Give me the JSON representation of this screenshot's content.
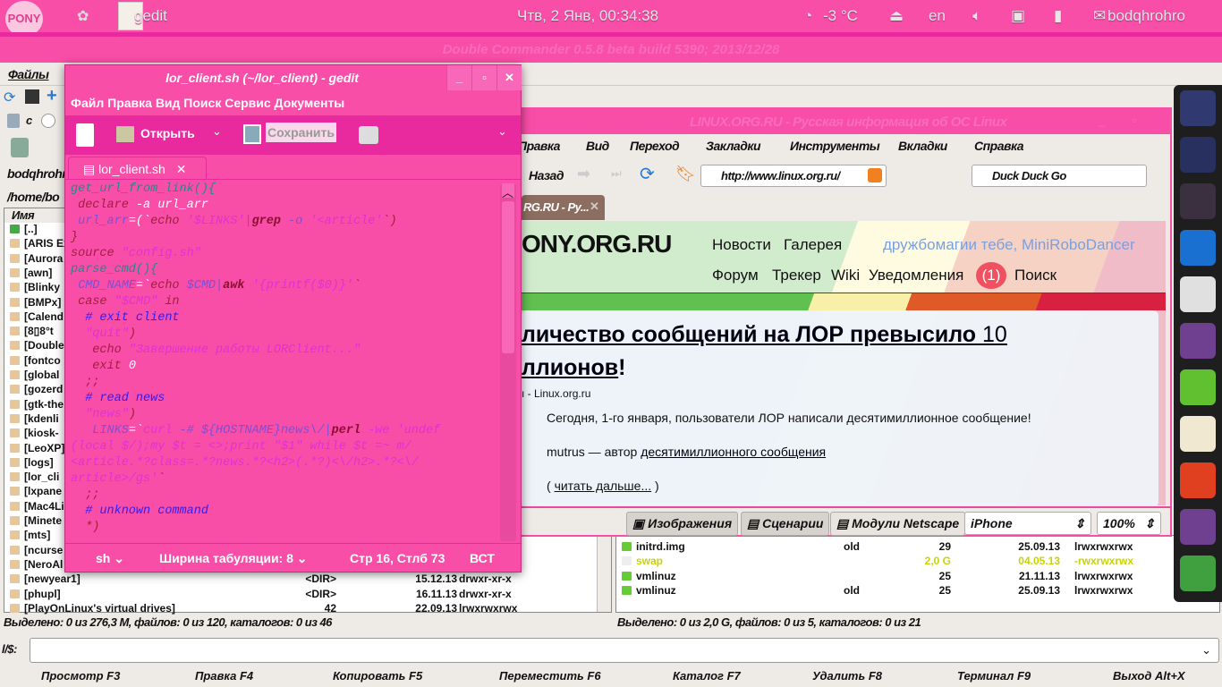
{
  "top_panel": {
    "app_name": "gedit",
    "clock": "Чтв,  2 Янв, 00:34:38",
    "weather": "-3 °C",
    "keyboard": "en",
    "user": "bodqhrohro",
    "logo_text": "My Little Pony"
  },
  "dc": {
    "title": "Double Commander 0.5.8 beta build 5390; 2013/12/28",
    "menu": [
      "Файлы"
    ],
    "drive_label": "c",
    "left": {
      "host": "bodqhrohro",
      "path": "/home/bo",
      "col_name": "Имя",
      "rows": [
        "[..]",
        "[ARIS Ex",
        "[Aurora",
        "[awn]",
        "[Blinky",
        "[BMPx]",
        "[Calend",
        "[8▯8°t",
        "[Double",
        "[fontco",
        "[global",
        "[gozerd",
        "[gtk-the",
        "[kdenli",
        "[kiosk-",
        "[LeoXP]",
        "[logs]",
        "[lor_cli",
        "[lxpane",
        "[Mac4Li",
        "[Minete",
        "[mts]",
        "[ncurse",
        "[NeroAl"
      ],
      "full_rows": [
        {
          "name": "[newyear1]",
          "size": "<DIR>",
          "date": "15.12.13",
          "attr": "drwxr-xr-x"
        },
        {
          "name": "[phupl]",
          "size": "<DIR>",
          "date": "16.11.13",
          "attr": "drwxr-xr-x"
        },
        {
          "name": "[PlayOnLinux's virtual drives]",
          "size": "42",
          "date": "22.09.13",
          "attr": "lrwxrwxrwx"
        }
      ],
      "status": "Выделено: 0 из 276,3 M, файлов: 0 из 120, каталогов: 0 из 46"
    },
    "right": {
      "rows": [
        {
          "name": "initrd.img",
          "ext": "old",
          "size": "29",
          "date": "25.09.13",
          "attr": "lrwxrwxrwx"
        },
        {
          "name": "swap",
          "ext": "",
          "size": "2,0 G",
          "date": "04.05.13",
          "attr": "-rwxrwxrwx",
          "highlight": "#c8d400"
        },
        {
          "name": "vmlinuz",
          "ext": "",
          "size": "25",
          "date": "21.11.13",
          "attr": "lrwxrwxrwx"
        },
        {
          "name": "vmlinuz",
          "ext": "old",
          "size": "25",
          "date": "25.09.13",
          "attr": "lrwxrwxrwx"
        }
      ],
      "status": "Выделено: 0 из 2,0 G, файлов: 0 из 5, каталогов: 0 из 21"
    },
    "cmdline_label": "l/$:",
    "fkeys": [
      "Просмотр F3",
      "Правка F4",
      "Копировать F5",
      "Переместить F6",
      "Каталог F7",
      "Удалить F8",
      "Терминал F9",
      "Выход Alt+X"
    ]
  },
  "gedit": {
    "title": "lor_client.sh (~/lor_client) - gedit",
    "menu": "Файл Правка Вид Поиск Сервис Документы",
    "open": "Открыть",
    "save": "Сохранить",
    "tab": "lor_client.sh",
    "code": [
      [
        [
          "get_url_from_link(){",
          "f"
        ]
      ],
      [
        [
          " declare",
          "k"
        ],
        [
          " -a url_arr",
          "n"
        ]
      ],
      [
        [
          " url_arr",
          "v"
        ],
        [
          "=(`",
          "n"
        ],
        [
          "echo",
          "k"
        ],
        [
          " '$LINKS'",
          "s"
        ],
        [
          "|",
          "v"
        ],
        [
          "grep",
          "b"
        ],
        [
          " -o",
          "v"
        ],
        [
          " '<article'",
          "s"
        ],
        [
          "`)",
          "k"
        ]
      ],
      [
        [
          "}",
          "k"
        ]
      ],
      [
        [
          "source",
          "k"
        ],
        [
          " \"config.sh\"",
          "s"
        ]
      ],
      [
        [
          "parse_cmd(){",
          "f"
        ]
      ],
      [
        [
          " CMD_NAME",
          "v"
        ],
        [
          "=`",
          "n"
        ],
        [
          "echo",
          "k"
        ],
        [
          " $CMD",
          "v"
        ],
        [
          "|",
          "v"
        ],
        [
          "awk",
          "b"
        ],
        [
          " '{printf($0)}'",
          "s"
        ],
        [
          "`",
          "k"
        ]
      ],
      [
        [
          " case",
          "k"
        ],
        [
          " \"$CMD\"",
          "s"
        ],
        [
          " in",
          "k"
        ]
      ],
      [
        [
          "  # exit client",
          "c"
        ]
      ],
      [
        [
          "  \"quit\"",
          "s"
        ],
        [
          ")",
          "k"
        ]
      ],
      [
        [
          "   echo",
          "k"
        ],
        [
          " \"Завершение работы LORClient...\"",
          "s"
        ]
      ],
      [
        [
          "   exit",
          "k"
        ],
        [
          " 0",
          "n"
        ]
      ],
      [
        [
          "  ;;",
          "k"
        ]
      ],
      [
        [
          "  # read news",
          "c"
        ]
      ],
      [
        [
          "  \"news\"",
          "s"
        ],
        [
          ")",
          "k"
        ]
      ],
      [
        [
          "   LINKS",
          "v"
        ],
        [
          "=`",
          "n"
        ],
        [
          "curl",
          "s"
        ],
        [
          " -# ${HOSTNAME}",
          "v"
        ],
        [
          "news\\/",
          "v"
        ],
        [
          "|",
          "v"
        ],
        [
          "perl",
          "b"
        ],
        [
          " -we 'undef",
          "s"
        ]
      ],
      [
        [
          "(local $/);my $t = <>;print \"$1\" while $t =~ m/",
          "s"
        ]
      ],
      [
        [
          "<article.*?class=.*?news.*?<h2>(.*?)<\\/h2>.*?<\\/",
          "s"
        ]
      ],
      [
        [
          "article>/gs'",
          "s"
        ],
        [
          "`",
          "k"
        ]
      ],
      [
        [
          "  ;;",
          "k"
        ]
      ],
      [
        [
          "  # unknown command",
          "c"
        ]
      ],
      [
        [
          "  *)",
          "k"
        ]
      ]
    ],
    "status": {
      "lang": "sh",
      "tab_width": "Ширина табуляции:  8",
      "position": "Стр 16, Стлб 73",
      "mode": "ВСТ"
    }
  },
  "browser": {
    "title": "LINUX.ORG.RU - Русская информация об ОС Linux",
    "menu": [
      "Правка",
      "Вид",
      "Переход",
      "Закладки",
      "Инструменты",
      "Вкладки",
      "Справка"
    ],
    "back": "Назад",
    "url": "http://www.linux.org.ru/",
    "search": "Duck Duck Go",
    "tab": "RG.RU - Ру...",
    "page": {
      "logo": "ONY.ORG.RU",
      "nav1": [
        "Новости",
        "Галерея"
      ],
      "greeting": "дружбомагии тебе, MiniRoboDancer",
      "nav2": [
        "Форум",
        "Трекер",
        "Wiki",
        "Уведомления"
      ],
      "notif": "(1)",
      "search": "Поиск",
      "headline1": "личество сообщений на ЛОР превысило",
      "headline1b": " 10",
      "headline2": "ллионов",
      "headline2b": "!",
      "source": "ı - Linux.org.ru",
      "p1": "Сегодня, 1-го января, пользователи ЛОР написали десятимиллионное сообщение!",
      "author": "mutrus",
      "p2": " — автор ",
      "p2link": "десятимиллионного сообщения",
      "more_open": "( ",
      "more": "читать дальше...",
      "more_close": " )"
    },
    "bottom": {
      "images": "Изображения",
      "scripts": "Сценарии",
      "plugins": "Модули Netscape",
      "ua": "iPhone",
      "zoom": "100%"
    }
  },
  "colors": {
    "accent": "#f84ea8",
    "accent_dark": "#e82a9e"
  }
}
